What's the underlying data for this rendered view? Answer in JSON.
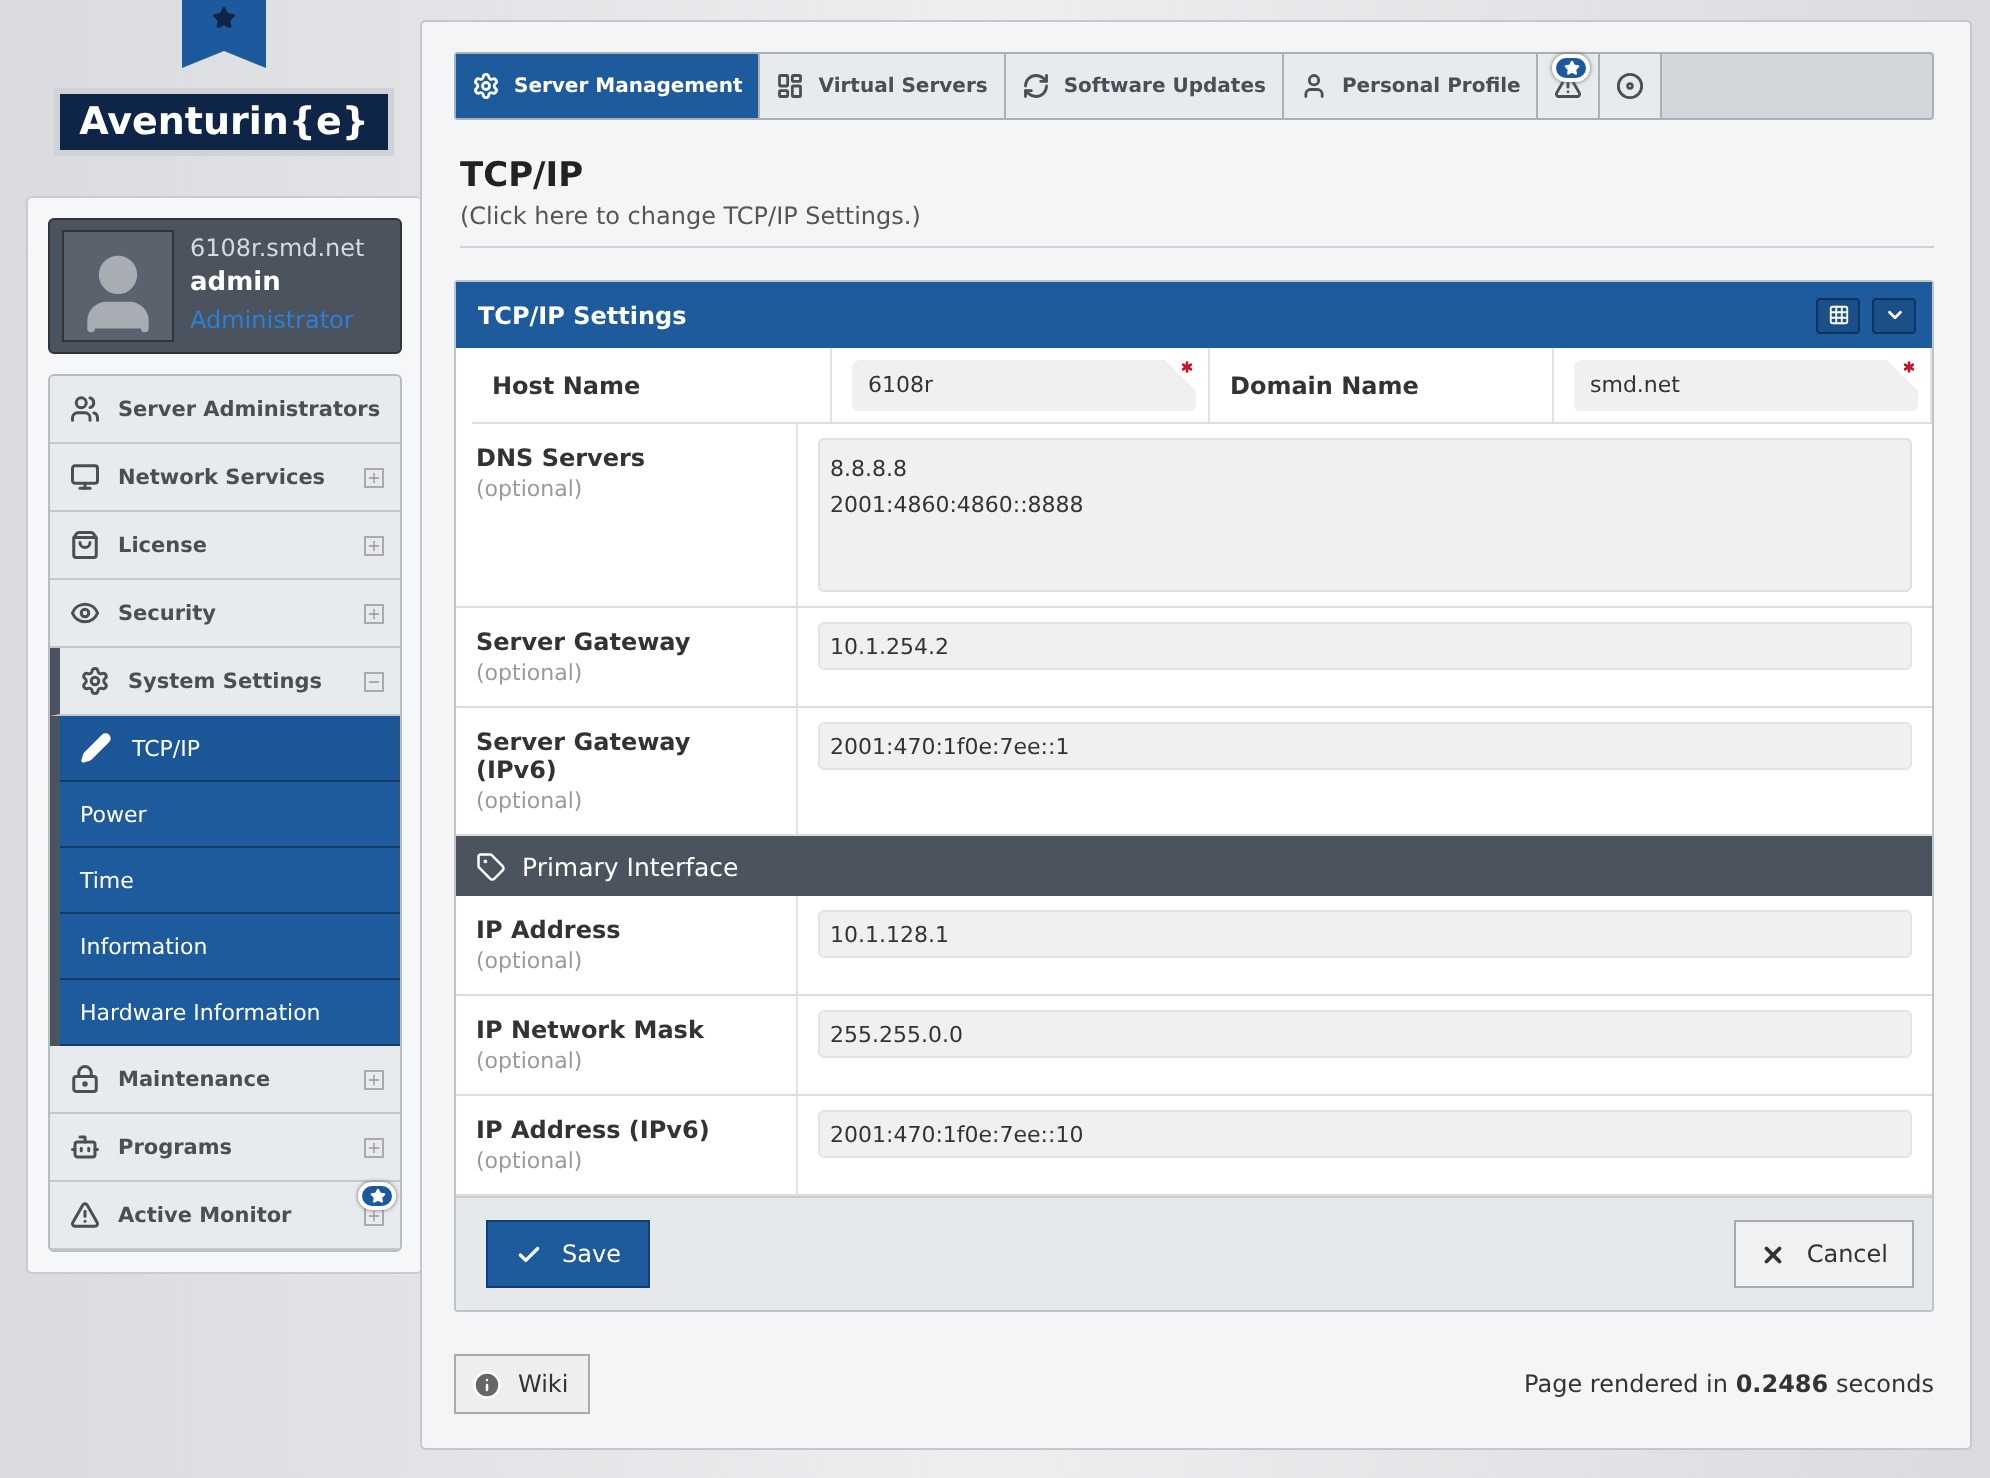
{
  "brand": {
    "logo": "Aventurin{e}"
  },
  "user": {
    "host": "6108r.smd.net",
    "name": "admin",
    "role": "Administrator"
  },
  "sidebar": {
    "items": [
      {
        "label": "Server Administrators",
        "expandable": false,
        "expanded": false,
        "badge": false
      },
      {
        "label": "Network Services",
        "expandable": true,
        "expanded": false,
        "badge": false
      },
      {
        "label": "License",
        "expandable": true,
        "expanded": false,
        "badge": false
      },
      {
        "label": "Security",
        "expandable": true,
        "expanded": false,
        "badge": false
      },
      {
        "label": "System Settings",
        "expandable": true,
        "expanded": true,
        "badge": false,
        "children": [
          {
            "label": "TCP/IP",
            "selected": true
          },
          {
            "label": "Power",
            "selected": false
          },
          {
            "label": "Time",
            "selected": false
          },
          {
            "label": "Information",
            "selected": false
          },
          {
            "label": "Hardware Information",
            "selected": false
          }
        ]
      },
      {
        "label": "Maintenance",
        "expandable": true,
        "expanded": false,
        "badge": false
      },
      {
        "label": "Programs",
        "expandable": true,
        "expanded": false,
        "badge": false
      },
      {
        "label": "Active Monitor",
        "expandable": true,
        "expanded": false,
        "badge": true
      }
    ]
  },
  "tabs": [
    {
      "label": "Server Management",
      "selected": true,
      "badge": false
    },
    {
      "label": "Virtual Servers",
      "selected": false,
      "badge": false
    },
    {
      "label": "Software Updates",
      "selected": false,
      "badge": false
    },
    {
      "label": "Personal Profile",
      "selected": false,
      "badge": false
    },
    {
      "selected": false,
      "badge": true
    },
    {
      "selected": false,
      "badge": false
    }
  ],
  "page": {
    "title": "TCP/IP",
    "subtitle": "(Click here to change TCP/IP Settings.)"
  },
  "panel": {
    "title": "TCP/IP Settings",
    "host_row": [
      {
        "label": "Host Name",
        "value": "6108r",
        "required": true
      },
      {
        "label": "Domain Name",
        "value": "smd.net",
        "required": true
      }
    ],
    "rows": [
      {
        "kind": "textarea",
        "label": "DNS Servers",
        "hint": "(optional)",
        "value": "8.8.8.8\n2001:4860:4860::8888"
      },
      {
        "kind": "input",
        "label": "Server Gateway",
        "hint": "(optional)",
        "value": "10.1.254.2"
      },
      {
        "kind": "input",
        "label": "Server Gateway (IPv6)",
        "hint": "(optional)",
        "value": "2001:470:1f0e:7ee::1"
      },
      {
        "kind": "section",
        "label": "Primary Interface"
      },
      {
        "kind": "input",
        "label": "IP Address",
        "hint": "(optional)",
        "value": "10.1.128.1"
      },
      {
        "kind": "input",
        "label": "IP Network Mask",
        "hint": "(optional)",
        "value": "255.255.0.0"
      },
      {
        "kind": "input",
        "label": "IP Address (IPv6)",
        "hint": "(optional)",
        "value": "2001:470:1f0e:7ee::10"
      }
    ],
    "buttons": {
      "save": "Save",
      "cancel": "Cancel"
    }
  },
  "footer": {
    "wiki": "Wiki",
    "rendered": "Page rendered in **0.2486** seconds"
  }
}
